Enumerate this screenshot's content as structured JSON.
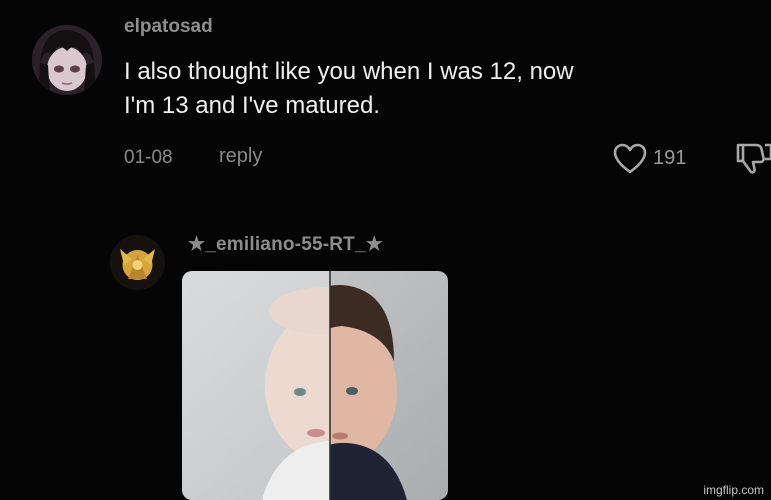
{
  "comment": {
    "username": "elpatosad",
    "text_line1": "I also thought like you when I was 12, now",
    "text_line2": "I'm 13 and I've matured.",
    "date": "01-08",
    "reply_label": "reply",
    "like_count": "191",
    "avatar_icon": "anime-avatar-icon",
    "like_icon": "heart-outline-icon",
    "dislike_icon": "thumbs-down-icon"
  },
  "reply": {
    "username": "★_emiliano-55-RT_★",
    "avatar_icon": "gold-emblem-avatar-icon",
    "image_icon": "baby-split-photo"
  },
  "watermark": "imgflip.com"
}
